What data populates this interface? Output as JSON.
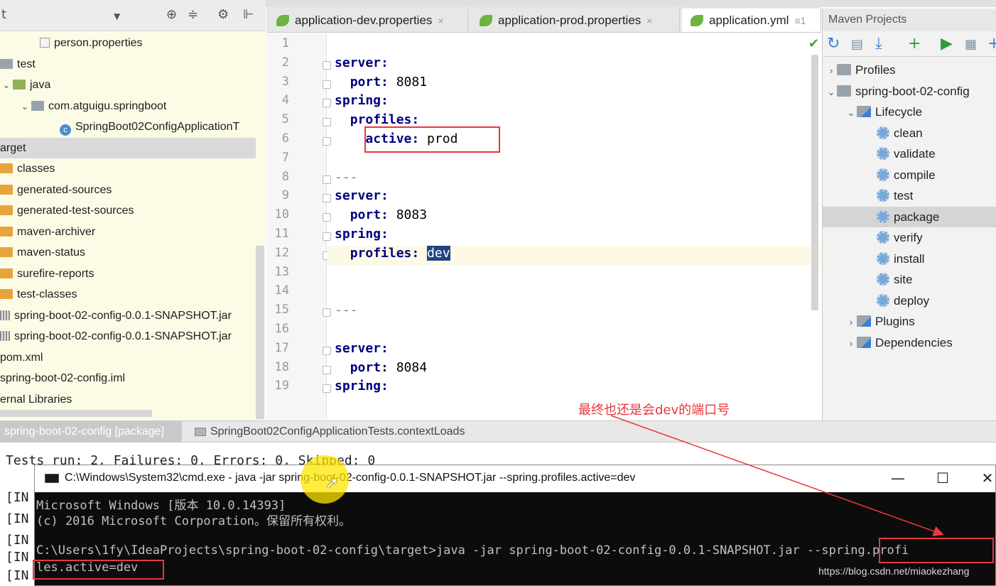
{
  "project_panel": {
    "header_text": "t",
    "tree": [
      {
        "label": "person.properties",
        "icon": "properties-file-icon",
        "indent": 3,
        "kind": "file"
      },
      {
        "label": "test",
        "icon": "folder-icon",
        "indent": 0,
        "kind": "folder-gray"
      },
      {
        "label": "java",
        "icon": "folder-icon",
        "indent": 0,
        "kind": "folder-green",
        "arrow": "v"
      },
      {
        "label": "com.atguigu.springboot",
        "icon": "package-icon",
        "indent": 1,
        "kind": "pkg",
        "arrow": "v"
      },
      {
        "label": "SpringBoot02ConfigApplicationT",
        "icon": "class-icon",
        "indent": 2,
        "kind": "cls"
      },
      {
        "label": "arget",
        "icon": "",
        "indent": 0,
        "kind": "none",
        "selected": true
      },
      {
        "label": "classes",
        "icon": "folder-icon",
        "indent": 0,
        "kind": "folder"
      },
      {
        "label": "generated-sources",
        "icon": "folder-icon",
        "indent": 0,
        "kind": "folder"
      },
      {
        "label": "generated-test-sources",
        "icon": "folder-icon",
        "indent": 0,
        "kind": "folder"
      },
      {
        "label": "maven-archiver",
        "icon": "folder-icon",
        "indent": 0,
        "kind": "folder"
      },
      {
        "label": "maven-status",
        "icon": "folder-icon",
        "indent": 0,
        "kind": "folder"
      },
      {
        "label": "surefire-reports",
        "icon": "folder-icon",
        "indent": 0,
        "kind": "folder"
      },
      {
        "label": "test-classes",
        "icon": "folder-icon",
        "indent": 0,
        "kind": "folder"
      },
      {
        "label": "spring-boot-02-config-0.0.1-SNAPSHOT.jar",
        "icon": "jar-icon",
        "indent": 0,
        "kind": "jar"
      },
      {
        "label": "spring-boot-02-config-0.0.1-SNAPSHOT.jar",
        "icon": "jar-icon",
        "indent": 0,
        "kind": "jar"
      },
      {
        "label": "pom.xml",
        "icon": "",
        "indent": 0,
        "kind": "none"
      },
      {
        "label": "spring-boot-02-config.iml",
        "icon": "",
        "indent": 0,
        "kind": "none"
      },
      {
        "label": "ernal Libraries",
        "icon": "",
        "indent": 0,
        "kind": "none"
      }
    ]
  },
  "editor": {
    "tabs": [
      {
        "label": "application-dev.properties",
        "close": "×"
      },
      {
        "label": "application-prod.properties",
        "close": "×"
      },
      {
        "label": "application.yml",
        "close": "≡1",
        "active": true
      }
    ],
    "lines": [
      {
        "n": "1",
        "indent": "",
        "key": "",
        "value": ""
      },
      {
        "n": "2",
        "indent": "",
        "key": "server:",
        "value": ""
      },
      {
        "n": "3",
        "indent": "  ",
        "key": "port:",
        "value": " 8081"
      },
      {
        "n": "4",
        "indent": "",
        "key": "spring:",
        "value": ""
      },
      {
        "n": "5",
        "indent": "  ",
        "key": "profiles:",
        "value": ""
      },
      {
        "n": "6",
        "indent": "    ",
        "key": "active:",
        "value": " prod"
      },
      {
        "n": "7",
        "indent": "",
        "key": "",
        "value": ""
      },
      {
        "n": "8",
        "indent": "",
        "key": "",
        "value": "---"
      },
      {
        "n": "9",
        "indent": "",
        "key": "server:",
        "value": ""
      },
      {
        "n": "10",
        "indent": "  ",
        "key": "port:",
        "value": " 8083"
      },
      {
        "n": "11",
        "indent": "",
        "key": "spring:",
        "value": ""
      },
      {
        "n": "12",
        "indent": "  ",
        "key": "profiles:",
        "value": " ",
        "selected": "dev"
      },
      {
        "n": "13",
        "indent": "",
        "key": "",
        "value": ""
      },
      {
        "n": "14",
        "indent": "",
        "key": "",
        "value": ""
      },
      {
        "n": "15",
        "indent": "",
        "key": "",
        "value": "---"
      },
      {
        "n": "16",
        "indent": "",
        "key": "",
        "value": ""
      },
      {
        "n": "17",
        "indent": "",
        "key": "server:",
        "value": ""
      },
      {
        "n": "18",
        "indent": "  ",
        "key": "port:",
        "value": " 8084"
      },
      {
        "n": "19",
        "indent": "",
        "key": "spring:",
        "value": ""
      }
    ]
  },
  "maven": {
    "title": "Maven Projects",
    "rows": [
      {
        "label": "Profiles",
        "arrow": ">",
        "indent": 0,
        "icon": "folder-icon"
      },
      {
        "label": "spring-boot-02-config",
        "arrow": "v",
        "indent": 0,
        "icon": "maven-project-icon"
      },
      {
        "label": "Lifecycle",
        "arrow": "v",
        "indent": 1,
        "icon": "folder-icon"
      },
      {
        "label": "clean",
        "indent": 2,
        "icon": "gear-icon"
      },
      {
        "label": "validate",
        "indent": 2,
        "icon": "gear-icon"
      },
      {
        "label": "compile",
        "indent": 2,
        "icon": "gear-icon"
      },
      {
        "label": "test",
        "indent": 2,
        "icon": "gear-icon"
      },
      {
        "label": "package",
        "indent": 2,
        "icon": "gear-icon",
        "selected": true
      },
      {
        "label": "verify",
        "indent": 2,
        "icon": "gear-icon"
      },
      {
        "label": "install",
        "indent": 2,
        "icon": "gear-icon"
      },
      {
        "label": "site",
        "indent": 2,
        "icon": "gear-icon"
      },
      {
        "label": "deploy",
        "indent": 2,
        "icon": "gear-icon"
      },
      {
        "label": "Plugins",
        "arrow": ">",
        "indent": 1,
        "icon": "folder-icon"
      },
      {
        "label": "Dependencies",
        "arrow": ">",
        "indent": 1,
        "icon": "folder-icon"
      }
    ]
  },
  "run": {
    "tabs": [
      {
        "label": "spring-boot-02-config [package]",
        "active": true
      },
      {
        "label": "SpringBoot02ConfigApplicationTests.contextLoads"
      }
    ],
    "summary_line": "Tests run: 2, Failures: 0, Errors: 0, Skipped: 0",
    "log_prefix": "[IN"
  },
  "cmd": {
    "title": "C:\\Windows\\System32\\cmd.exe - java  -jar spring-boot-02-config-0.0.1-SNAPSHOT.jar --spring.profiles.active=dev",
    "lines": [
      "Microsoft Windows [版本 10.0.14393]",
      "(c) 2016 Microsoft Corporation。保留所有权利。",
      "",
      "C:\\Users\\1fy\\IdeaProjects\\spring-boot-02-config\\target>java -jar spring-boot-02-config-0.0.1-SNAPSHOT.jar --spring.profi",
      "les.active=dev"
    ],
    "min": "—",
    "max": "☐",
    "close": "✕"
  },
  "annotation": "最终也还是会dev的端口号",
  "watermark": "https://blog.csdn.net/miaokezhang",
  "colors": {
    "annotation_red": "#e8373e",
    "selection_blue": "#214283",
    "yaml_key": "#000080"
  }
}
